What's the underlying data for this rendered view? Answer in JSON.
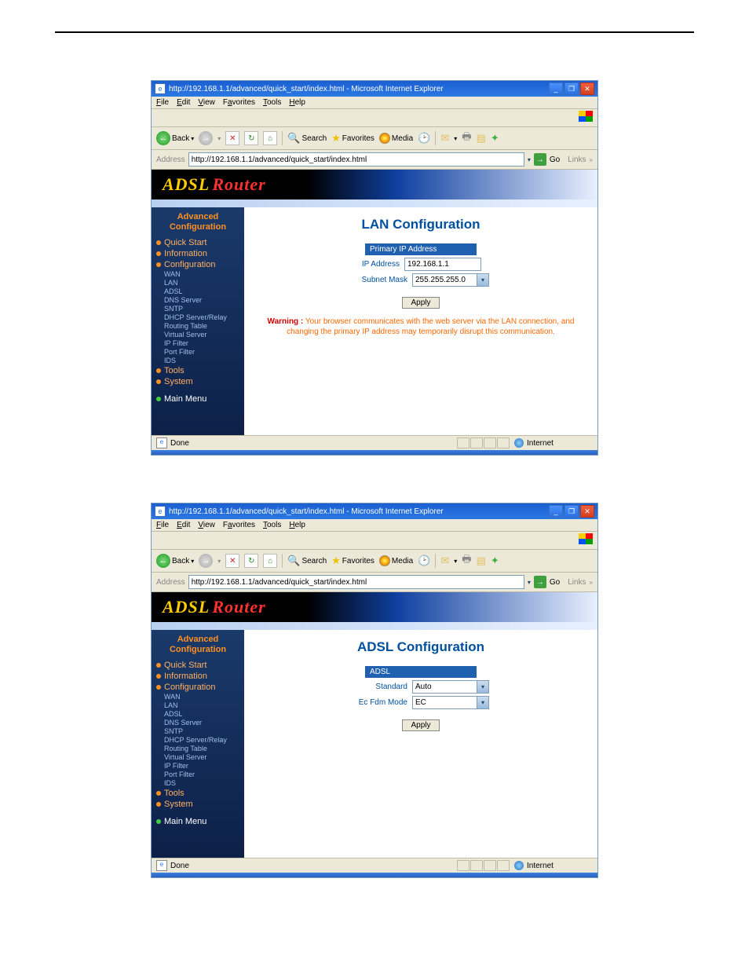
{
  "browser": {
    "title": "http://192.168.1.1/advanced/quick_start/index.html - Microsoft Internet Explorer",
    "menus": [
      "File",
      "Edit",
      "View",
      "Favorites",
      "Tools",
      "Help"
    ],
    "back": "Back",
    "search": "Search",
    "favorites": "Favorites",
    "media": "Media",
    "addr_label": "Address",
    "url": "http://192.168.1.1/advanced/quick_start/index.html",
    "go": "Go",
    "links": "Links",
    "done": "Done",
    "zone": "Internet"
  },
  "brand_a": "ADSL",
  "brand_r": "Router",
  "sidebar": {
    "hdr1": "Advanced",
    "hdr2": "Configuration",
    "quick": "Quick Start",
    "info": "Information",
    "config": "Configuration",
    "subs": [
      "WAN",
      "LAN",
      "ADSL",
      "DNS Server",
      "SNTP",
      "DHCP Server/Relay",
      "Routing Table",
      "Virtual Server",
      "IP Filter",
      "Port Filter",
      "IDS"
    ],
    "tools": "Tools",
    "system": "System",
    "mainmenu": "Main Menu"
  },
  "lan": {
    "title": "LAN Configuration",
    "section": "Primary IP Address",
    "ip_lbl": "IP Address",
    "ip_val": "192.168.1.1",
    "mask_lbl": "Subnet Mask",
    "mask_val": "255.255.255.0",
    "apply": "Apply",
    "warn_b": "Warning :",
    "warn": " Your browser communicates with the web server via the LAN connection, and changing the primary IP address may temporarily disrupt this communication."
  },
  "adsl": {
    "title": "ADSL Configuration",
    "section": "ADSL",
    "std_lbl": "Standard",
    "std_val": "Auto",
    "ec_lbl": "Ec Fdm Mode",
    "ec_val": "EC",
    "apply": "Apply"
  }
}
